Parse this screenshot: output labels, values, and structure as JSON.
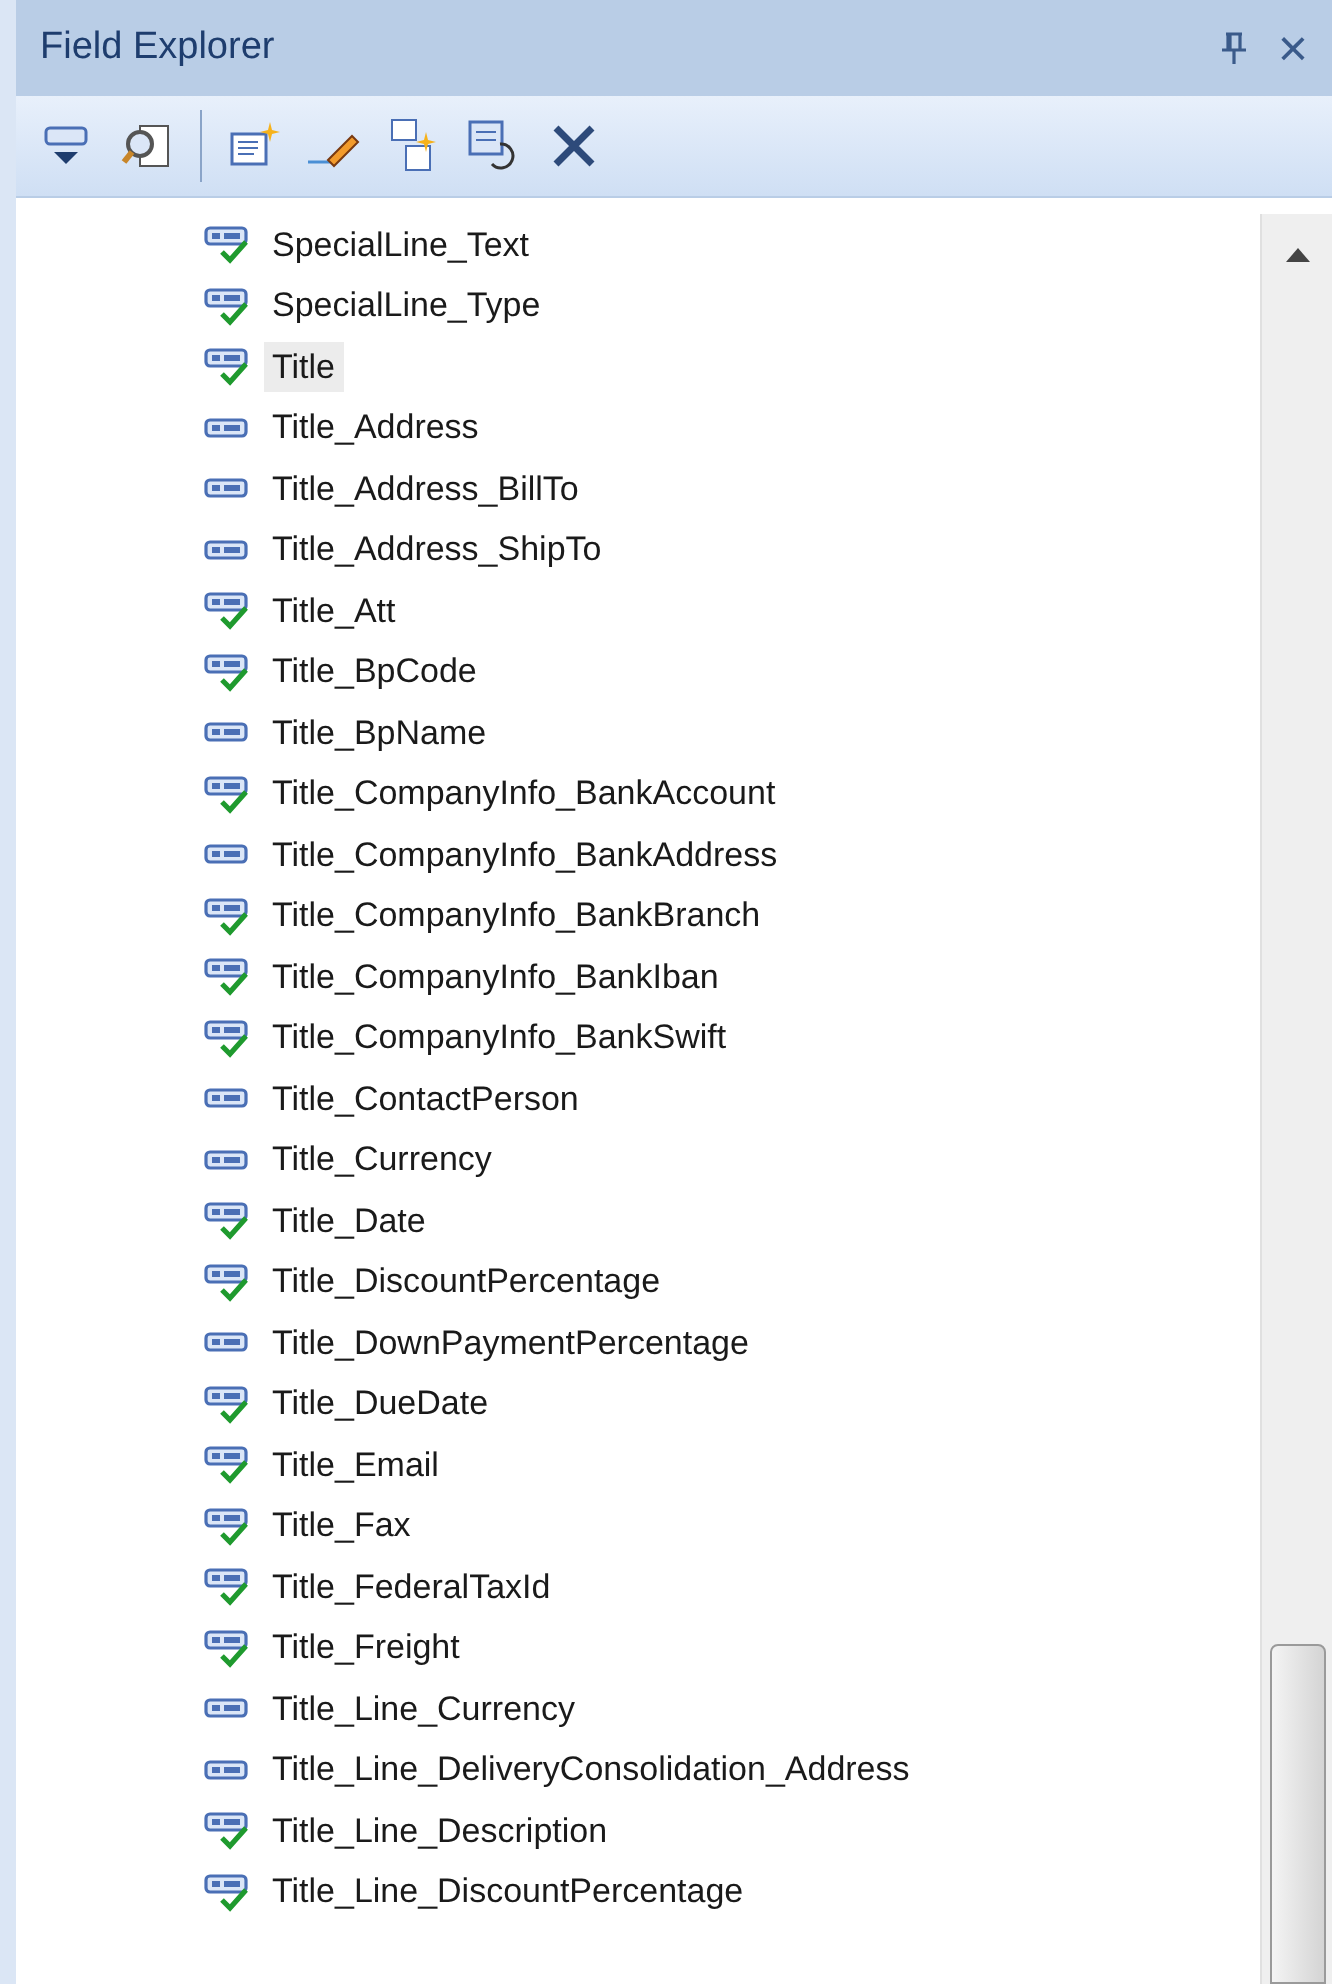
{
  "panel": {
    "title": "Field Explorer",
    "close": "×"
  },
  "fields": [
    {
      "name": "SpecialLine_Text",
      "used": true,
      "selected": false
    },
    {
      "name": "SpecialLine_Type",
      "used": true,
      "selected": false
    },
    {
      "name": "Title",
      "used": true,
      "selected": true
    },
    {
      "name": "Title_Address",
      "used": false,
      "selected": false
    },
    {
      "name": "Title_Address_BillTo",
      "used": false,
      "selected": false
    },
    {
      "name": "Title_Address_ShipTo",
      "used": false,
      "selected": false
    },
    {
      "name": "Title_Att",
      "used": true,
      "selected": false
    },
    {
      "name": "Title_BpCode",
      "used": true,
      "selected": false
    },
    {
      "name": "Title_BpName",
      "used": false,
      "selected": false
    },
    {
      "name": "Title_CompanyInfo_BankAccount",
      "used": true,
      "selected": false
    },
    {
      "name": "Title_CompanyInfo_BankAddress",
      "used": false,
      "selected": false
    },
    {
      "name": "Title_CompanyInfo_BankBranch",
      "used": true,
      "selected": false
    },
    {
      "name": "Title_CompanyInfo_BankIban",
      "used": true,
      "selected": false
    },
    {
      "name": "Title_CompanyInfo_BankSwift",
      "used": true,
      "selected": false
    },
    {
      "name": "Title_ContactPerson",
      "used": false,
      "selected": false
    },
    {
      "name": "Title_Currency",
      "used": false,
      "selected": false
    },
    {
      "name": "Title_Date",
      "used": true,
      "selected": false
    },
    {
      "name": "Title_DiscountPercentage",
      "used": true,
      "selected": false
    },
    {
      "name": "Title_DownPaymentPercentage",
      "used": false,
      "selected": false
    },
    {
      "name": "Title_DueDate",
      "used": true,
      "selected": false
    },
    {
      "name": "Title_Email",
      "used": true,
      "selected": false
    },
    {
      "name": "Title_Fax",
      "used": true,
      "selected": false
    },
    {
      "name": "Title_FederalTaxId",
      "used": true,
      "selected": false
    },
    {
      "name": "Title_Freight",
      "used": true,
      "selected": false
    },
    {
      "name": "Title_Line_Currency",
      "used": false,
      "selected": false
    },
    {
      "name": "Title_Line_DeliveryConsolidation_Address",
      "used": false,
      "selected": false
    },
    {
      "name": "Title_Line_Description",
      "used": true,
      "selected": false
    },
    {
      "name": "Title_Line_DiscountPercentage",
      "used": true,
      "selected": false
    }
  ]
}
